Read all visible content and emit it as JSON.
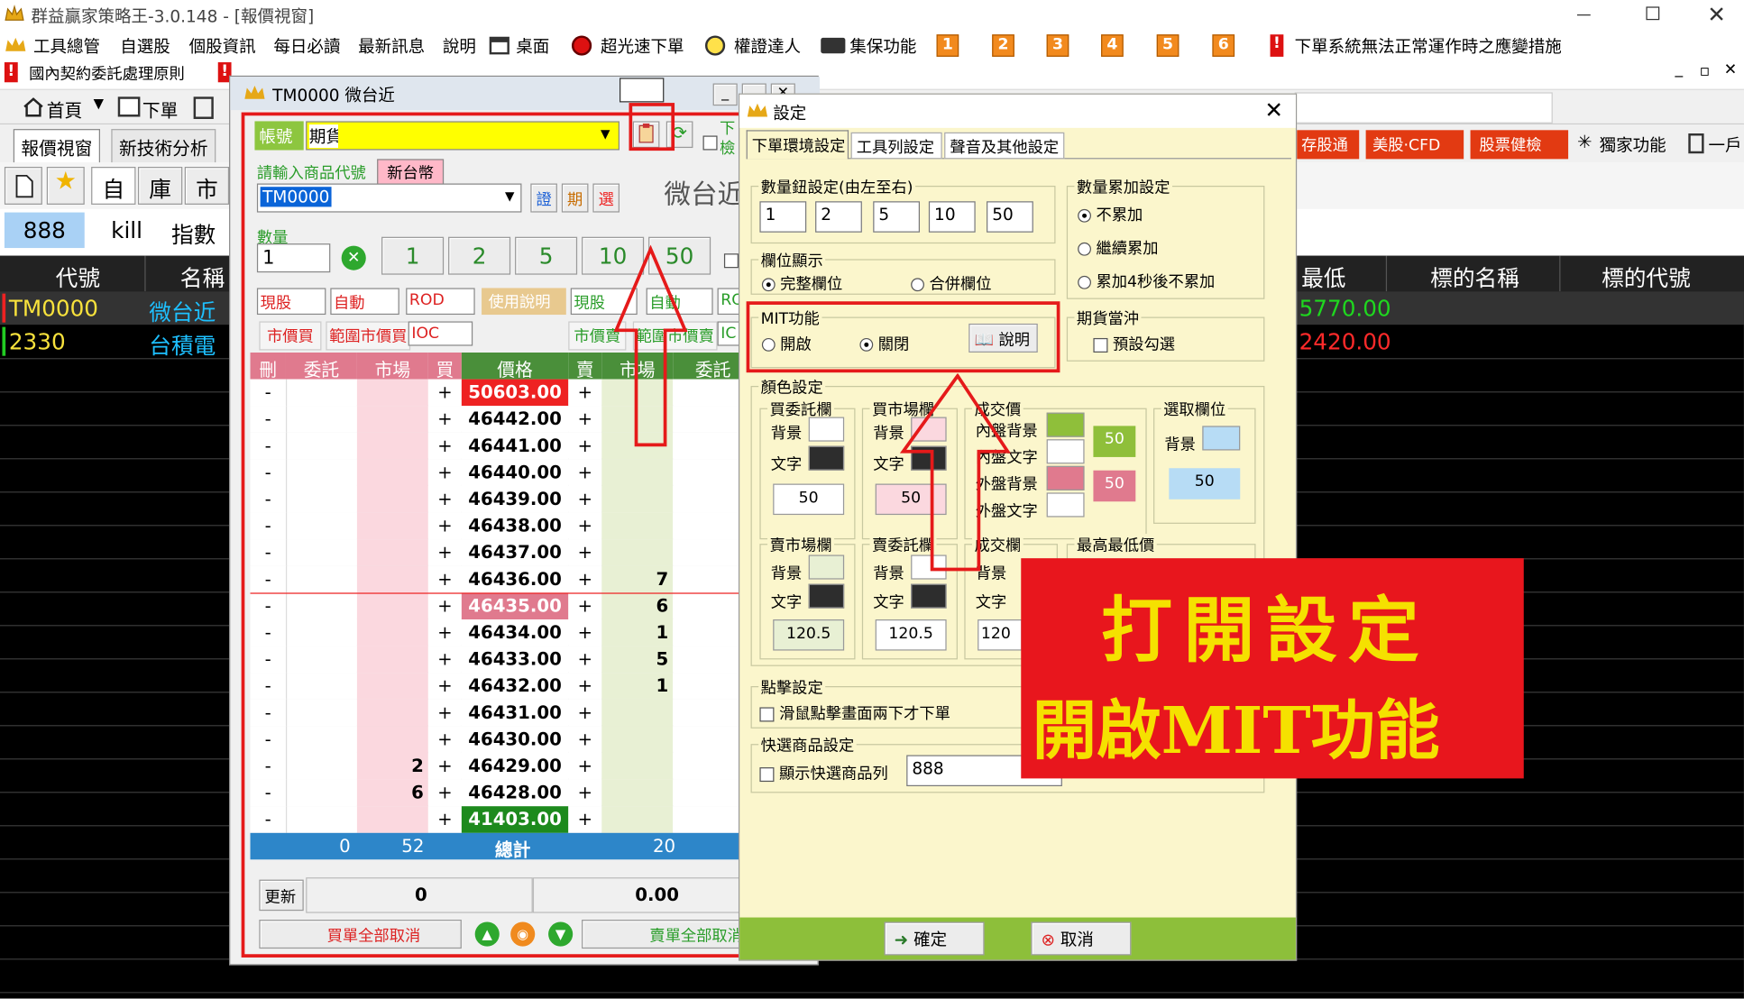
{
  "app": {
    "title": "群益贏家策略王-3.0.148 - [報價視窗]"
  },
  "menu": {
    "items": [
      "工具總管",
      "自選股",
      "個股資訊",
      "每日必讀",
      "最新訊息",
      "說明",
      "桌面",
      "超光速下單",
      "權證達人",
      "集保功能"
    ],
    "numbers": [
      "1",
      "2",
      "3",
      "4",
      "5",
      "6"
    ],
    "notice": "下單系統無法正常運作時之應變措施"
  },
  "menu2": {
    "left": "國內契約委託處理原則"
  },
  "toolbar": {
    "home": "首頁",
    "order": "下單"
  },
  "tabs": {
    "quote": "報價視窗",
    "tech": "新技術分析"
  },
  "right_toolbar": {
    "items": [
      "存股通",
      "美股‧CFD",
      "股票健檢",
      "獨家功能",
      "一戶"
    ]
  },
  "iconrow": {
    "self": "自",
    "stock": "庫",
    "market": "市"
  },
  "quick": {
    "a": "888",
    "b": "kill",
    "c": "指數"
  },
  "table": {
    "headers": {
      "code": "代號",
      "name": "名稱",
      "low": "最低",
      "under_name": "標的名稱",
      "under_code": "標的代號"
    },
    "rows": [
      {
        "code": "TM0000",
        "name": "微台近",
        "low": "5770.00"
      },
      {
        "code": "2330",
        "name": "台積電",
        "low": "2420.00"
      }
    ]
  },
  "order_window": {
    "title": "TM0000 微台近",
    "account_label": "帳號",
    "account_value": "期貨",
    "product_prompt": "請輸入商品代號",
    "currency": "新台幣",
    "product_code": "TM0000",
    "btn_a": "證",
    "btn_b": "期",
    "btn_c": "選",
    "big_name": "微台近",
    "qty_label": "數量",
    "qty_value": "1",
    "qty_buttons": [
      "1",
      "2",
      "5",
      "10",
      "50"
    ],
    "sel": {
      "s1": "現股",
      "s2": "自動",
      "s3": "ROD",
      "help": "使用說明",
      "s4": "現股",
      "s5": "自動",
      "s6": "RO"
    },
    "mkt": {
      "m1": "市價買",
      "m2": "範圍市價買",
      "m3": "IOC",
      "m4": "市價賣",
      "m5": "範圍市價賣",
      "m6": "IC"
    },
    "side_text": {
      "l1": "下",
      "l2": "檢"
    },
    "headers": {
      "del": "刪",
      "entrust": "委託",
      "market": "市場",
      "buy": "買",
      "price": "價格",
      "sell": "賣",
      "smarket": "市場",
      "sentrust": "委託"
    },
    "rows": [
      {
        "price": "50603.00",
        "bmkt": "",
        "smkt": "",
        "style": "limitup"
      },
      {
        "price": "46442.00",
        "bmkt": "",
        "smkt": "",
        "style": ""
      },
      {
        "price": "46441.00",
        "bmkt": "",
        "smkt": "",
        "style": ""
      },
      {
        "price": "46440.00",
        "bmkt": "",
        "smkt": "",
        "style": ""
      },
      {
        "price": "46439.00",
        "bmkt": "",
        "smkt": "",
        "style": ""
      },
      {
        "price": "46438.00",
        "bmkt": "",
        "smkt": "",
        "style": ""
      },
      {
        "price": "46437.00",
        "bmkt": "",
        "smkt": "",
        "style": ""
      },
      {
        "price": "46436.00",
        "bmkt": "",
        "smkt": "7",
        "style": ""
      },
      {
        "price": "46435.00",
        "bmkt": "",
        "smkt": "6",
        "style": "current"
      },
      {
        "price": "46434.00",
        "bmkt": "",
        "smkt": "1",
        "style": ""
      },
      {
        "price": "46433.00",
        "bmkt": "",
        "smkt": "5",
        "style": ""
      },
      {
        "price": "46432.00",
        "bmkt": "",
        "smkt": "1",
        "style": ""
      },
      {
        "price": "46431.00",
        "bmkt": "",
        "smkt": "",
        "style": ""
      },
      {
        "price": "46430.00",
        "bmkt": "",
        "smkt": "",
        "style": ""
      },
      {
        "price": "46429.00",
        "bmkt": "2",
        "smkt": "",
        "style": ""
      },
      {
        "price": "46428.00",
        "bmkt": "6",
        "smkt": "",
        "style": ""
      },
      {
        "price": "41403.00",
        "bmkt": "",
        "smkt": "",
        "style": "limitdown"
      }
    ],
    "minus": "-",
    "plus": "+",
    "total": {
      "a": "0",
      "b": "52",
      "label": "總計",
      "c": "20"
    },
    "update": "更新",
    "f1": "0",
    "f2": "0.00",
    "cancel_buy": "買單全部取消",
    "cancel_sell": "賣單全部取消"
  },
  "settings": {
    "title": "設定",
    "tabs": [
      "下單環境設定",
      "工具列設定",
      "聲音及其他設定"
    ],
    "qty_group": "數量鈕設定(由左至右)",
    "qty_values": [
      "1",
      "2",
      "5",
      "10",
      "50"
    ],
    "accum_group": "數量累加設定",
    "accum_opts": [
      "不累加",
      "繼續累加",
      "累加4秒後不累加"
    ],
    "field_group": "欄位顯示",
    "field_opts": [
      "完整欄位",
      "合併欄位"
    ],
    "mit_group": "MIT功能",
    "mit_opts": [
      "開啟",
      "關閉"
    ],
    "mit_help": "說明",
    "offset_group": "期貨當沖",
    "offset_opt": "預設勾選",
    "color_group": "顏色設定",
    "buy_entrust": "買委託欄",
    "buy_market": "買市場欄",
    "deal_price": "成交價",
    "select_field": "選取欄位",
    "bg": "背景",
    "text": "文字",
    "inner_bg": "內盤背景",
    "inner_text": "內盤文字",
    "outer_bg": "外盤背景",
    "outer_text": "外盤文字",
    "v50": "50",
    "sell_market": "賣市場欄",
    "sell_entrust": "賣委託欄",
    "deal_field": "成交欄",
    "hilo": "最高最低價",
    "v120": "120.5",
    "v120b": "120",
    "click_group": "點擊設定",
    "click_opt": "滑鼠點擊畫面兩下才下單",
    "quick_group": "快選商品設定",
    "quick_opt": "顯示快選商品列",
    "quick_value": "888",
    "ok": "確定",
    "cancel": "取消"
  },
  "annotation": {
    "line1": "打開設定",
    "line2": "開啟MIT功能"
  },
  "colors": {
    "accent_red": "#e51a1a",
    "annotation_bg": "#e8161d",
    "annotation_text": "#f5e100",
    "yellow": "#ffff00"
  }
}
